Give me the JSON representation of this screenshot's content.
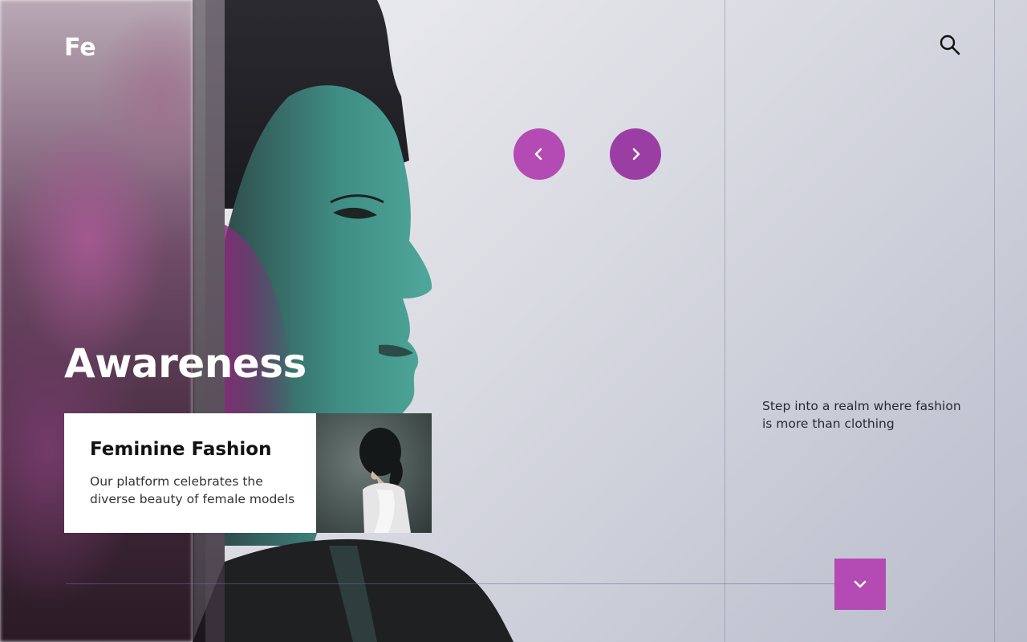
{
  "brand": {
    "logo": "Fe"
  },
  "header": {
    "search_icon": "search-icon"
  },
  "slider": {
    "prev_icon": "chevron-left-icon",
    "next_icon": "chevron-right-icon",
    "headline": "Awareness"
  },
  "card": {
    "title": "Feminine Fashion",
    "text": "Our platform celebrates the diverse beauty of female models"
  },
  "side": {
    "tagline": "Step into a realm where fashion is more than clothing"
  },
  "footer": {
    "scroll_down_icon": "chevron-down-icon"
  },
  "colors": {
    "accent": "#b44bb4",
    "accent_dark": "#9b3ea3",
    "portrait_teal": "#3e8a80",
    "background": "#dcdde4"
  }
}
